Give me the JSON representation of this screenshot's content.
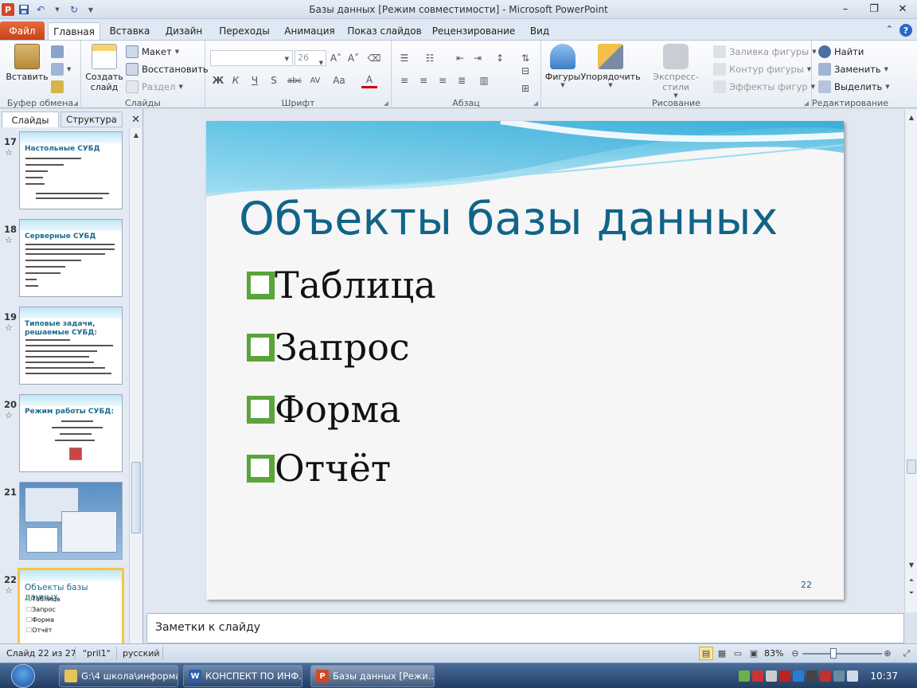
{
  "window": {
    "title": "Базы данных [Режим совместимости] - Microsoft PowerPoint",
    "app_icon": "P",
    "controls": [
      "minimize-icon",
      "restore-icon",
      "close-icon"
    ]
  },
  "quick_access": {
    "icons": [
      "save-icon",
      "undo-icon",
      "redo-icon",
      "customize-icon"
    ]
  },
  "ribbon_tabs": {
    "file": "Файл",
    "tabs": [
      "Главная",
      "Вставка",
      "Дизайн",
      "Переходы",
      "Анимация",
      "Показ слайдов",
      "Рецензирование",
      "Вид"
    ],
    "active": "Главная"
  },
  "ribbon": {
    "clipboard": {
      "label": "Буфер обмена",
      "paste": "Вставить"
    },
    "slides": {
      "label": "Слайды",
      "new_slide": "Создать слайд",
      "layout": "Макет",
      "reset": "Восстановить",
      "section": "Раздел"
    },
    "font": {
      "label": "Шрифт",
      "font_name": "",
      "font_size": "26",
      "buttons": [
        "Ж",
        "К",
        "Ч",
        "S",
        "abc",
        "AV",
        "Aa",
        "A"
      ]
    },
    "paragraph": {
      "label": "Абзац"
    },
    "drawing": {
      "label": "Рисование",
      "shapes": "Фигуры",
      "arrange": "Упорядочить",
      "quick_styles": "Экспресс-стили",
      "shape_fill": "Заливка фигуры",
      "shape_outline": "Контур фигуры",
      "shape_effects": "Эффекты фигур"
    },
    "editing": {
      "label": "Редактирование",
      "find": "Найти",
      "replace": "Заменить",
      "select": "Выделить"
    }
  },
  "left_pane": {
    "tabs": [
      "Слайды",
      "Структура"
    ],
    "thumbnails": [
      {
        "num": "17",
        "title": "Настольные  СУБД"
      },
      {
        "num": "18",
        "title": "Серверные СУБД"
      },
      {
        "num": "19",
        "title": "Типовые задачи, решаемые СУБД:"
      },
      {
        "num": "20",
        "title": "Режим работы СУБД:"
      },
      {
        "num": "21",
        "title": ""
      },
      {
        "num": "22",
        "title": "Объекты базы данных",
        "items": [
          "Таблица",
          "Запрос",
          "Форма",
          "Отчёт"
        ]
      }
    ]
  },
  "slide": {
    "title": "Объекты базы данных",
    "bullets": [
      "Таблица",
      "Запрос",
      "Форма",
      "Отчёт"
    ],
    "number": "22",
    "colors": {
      "title": "#10648a",
      "bullet_box": "#5aa53a"
    }
  },
  "notes": {
    "placeholder": "Заметки к слайду"
  },
  "status": {
    "slide_info": "Слайд 22 из 27",
    "theme": "\"pril1\"",
    "language": "русский",
    "zoom": "83%",
    "zoom_fraction": 0.36
  },
  "taskbar": {
    "buttons": [
      {
        "label": "G:\\4 школа\\информа...",
        "icon": "folder-icon"
      },
      {
        "label": "КОНСПЕКТ ПО ИНФ...",
        "icon": "word-icon"
      },
      {
        "label": "Базы данных [Режи...",
        "icon": "powerpoint-icon"
      }
    ],
    "time": "10:37"
  }
}
